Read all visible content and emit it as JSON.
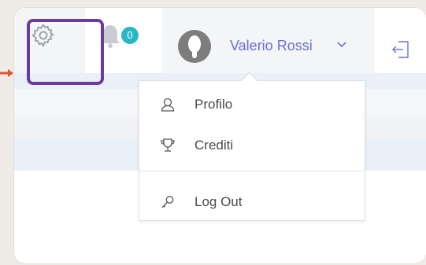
{
  "header": {
    "settings_icon": "gear-icon",
    "notifications": {
      "icon": "bell-icon",
      "count": "0"
    },
    "user": {
      "name": "Valerio Rossi",
      "avatar_icon": "avatar"
    },
    "logout_icon": "logout-icon"
  },
  "dropdown": {
    "items": [
      {
        "label": "Profilo",
        "icon": "user-icon"
      },
      {
        "label": "Crediti",
        "icon": "trophy-icon"
      },
      {
        "label": "Log Out",
        "icon": "key-icon"
      }
    ]
  },
  "colors": {
    "accent": "#6b6fd6",
    "badge": "#28b7c7",
    "highlight": "#6a3ca0",
    "pointer": "#e4542c"
  }
}
